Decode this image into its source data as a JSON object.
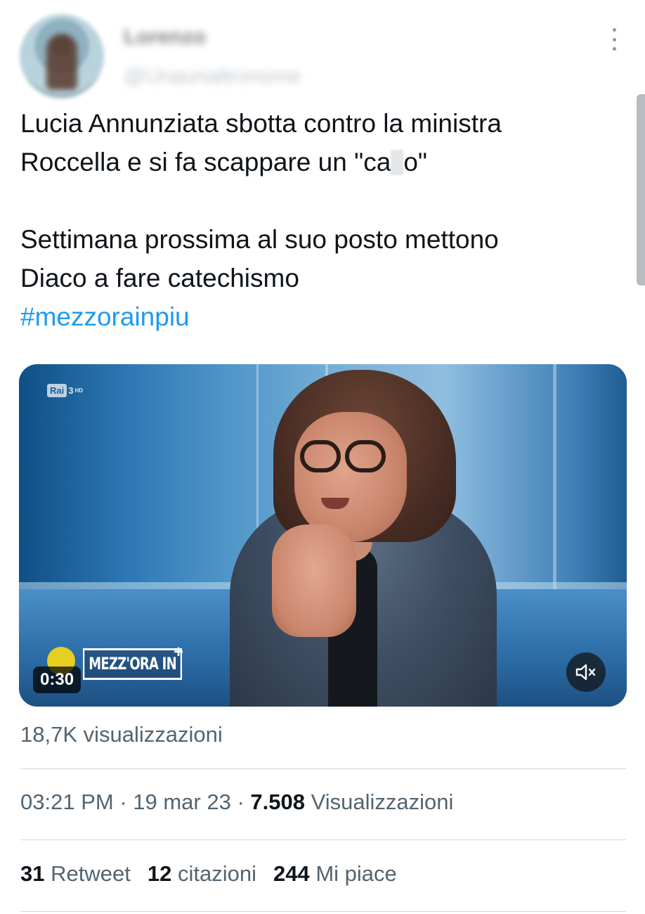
{
  "author": {
    "name": "Lorenzo",
    "handle": "@Unaunaltronome"
  },
  "tweet": {
    "text_line1": "Lucia Annunziata sbotta contro la ministra",
    "text_line2_prefix": "Roccella e si fa scappare un \"ca",
    "text_line2_suffix": "o\"",
    "text_paragraph2": "Settimana prossima al suo posto mettono\nDiaco a fare catechismo",
    "hashtag": "#mezzorainpiu"
  },
  "media": {
    "channel_rai": "Rai",
    "channel_number": "3",
    "channel_hd": "HD",
    "show_logo": "MEZZ'ORA IN",
    "show_plus": "+",
    "duration": "0:30",
    "mute_icon": "speaker-muted-icon"
  },
  "video_views": "18,7K visualizzazioni",
  "meta": {
    "time": "03:21 PM",
    "separator1": " · ",
    "date": "19 mar 23",
    "separator2": " · ",
    "views_count": "7.508",
    "views_label": "Visualizzazioni"
  },
  "stats": {
    "retweets_count": "31",
    "retweets_label": "Retweet",
    "quotes_count": "12",
    "quotes_label": "citazioni",
    "likes_count": "244",
    "likes_label": "Mi piace"
  },
  "colors": {
    "link": "#1d9bf0",
    "text": "#0f1419",
    "secondary": "#536471",
    "divider": "#cfd9de"
  }
}
